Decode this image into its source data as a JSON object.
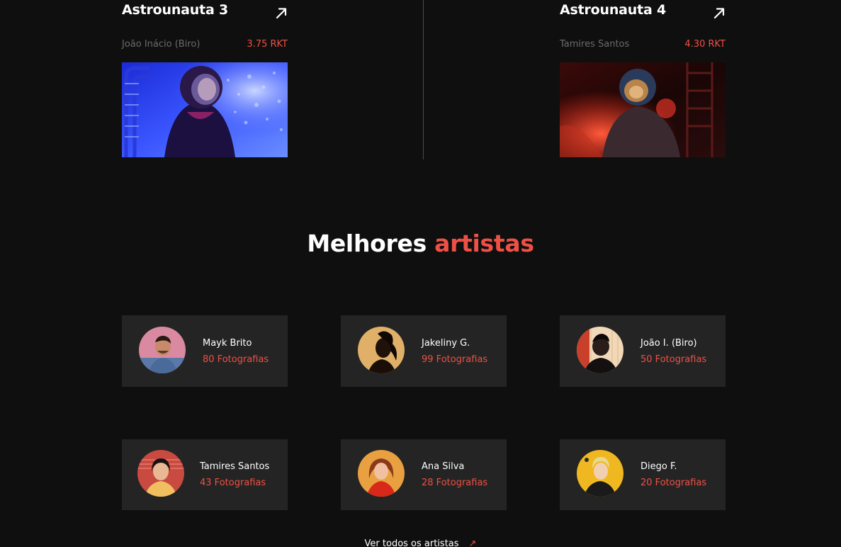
{
  "nfts": [
    {
      "title": "Astrounauta 3",
      "owner": "João Inácio (Biro)",
      "price": "3.75 RKT",
      "icon": "arrow-up-right-icon"
    },
    {
      "title": "Astrounauta 4",
      "owner": "Tamires Santos",
      "price": "4.30 RKT",
      "icon": "arrow-up-right-icon"
    }
  ],
  "section": {
    "title_main": "Melhores",
    "title_accent": "artistas"
  },
  "artists": [
    {
      "name": "Mayk Brito",
      "photos": "80 Fotografias"
    },
    {
      "name": "Jakeliny G.",
      "photos": "99 Fotografias"
    },
    {
      "name": "João I. (Biro)",
      "photos": "50 Fotografias"
    },
    {
      "name": "Tamires Santos",
      "photos": "43 Fotografias"
    },
    {
      "name": "Ana Silva",
      "photos": "28 Fotografias"
    },
    {
      "name": "Diego F.",
      "photos": "20 Fotografias"
    }
  ],
  "see_all": {
    "label": "Ver todos os artistas",
    "icon": "arrow-up-right-icon"
  },
  "colors": {
    "background": "#0f0f0f",
    "card": "#242424",
    "accent": "#ef5045",
    "muted": "#6b6b6b"
  }
}
